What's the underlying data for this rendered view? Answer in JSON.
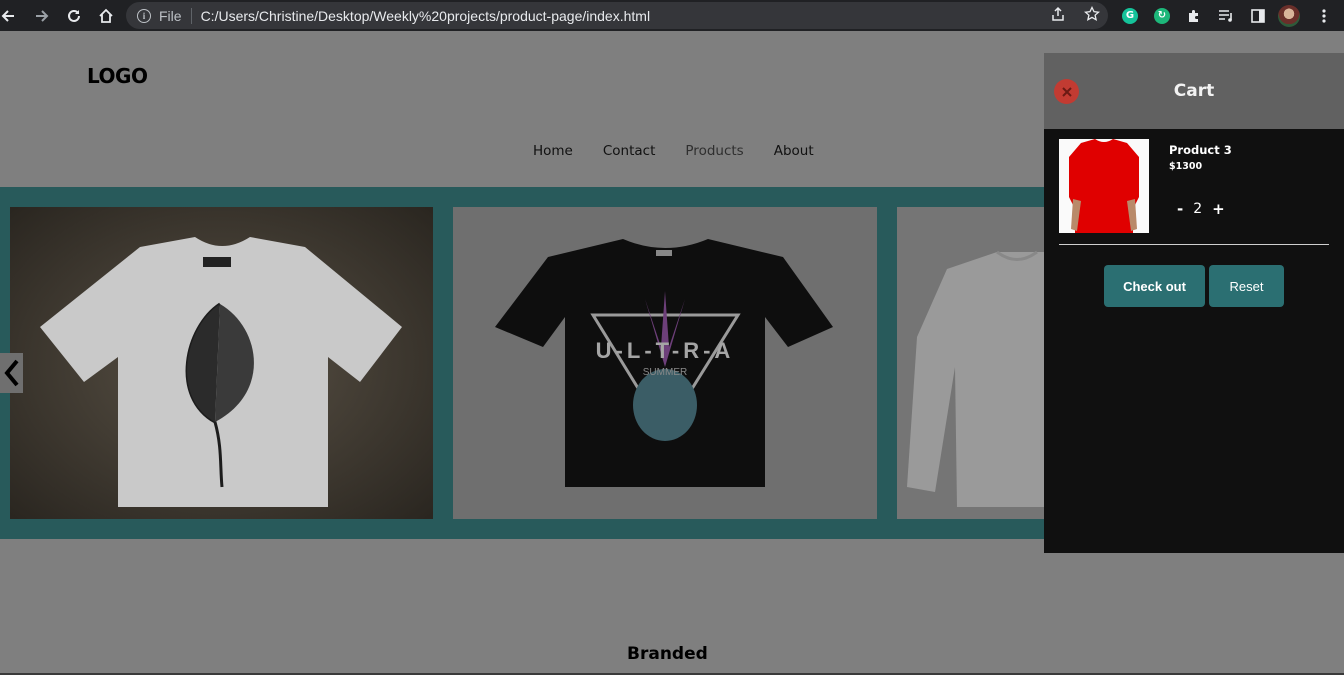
{
  "browser": {
    "protocol_label": "File",
    "url": "C:/Users/Christine/Desktop/Weekly%20projects/product-page/index.html"
  },
  "site": {
    "logo": "LOGO",
    "nav": [
      {
        "label": "Home"
      },
      {
        "label": "Contact"
      },
      {
        "label": "Products"
      },
      {
        "label": "About"
      }
    ],
    "section_title": "Branded"
  },
  "cart": {
    "title": "Cart",
    "item": {
      "name": "Product 3",
      "price": "$1300",
      "quantity": "2",
      "minus": "-",
      "plus": "+"
    },
    "checkout_label": "Check out",
    "reset_label": "Reset"
  },
  "colors": {
    "overlay_bg": "#7f7f7f",
    "carousel_bg": "#285a5b",
    "cart_bg": "#101010",
    "cart_header": "#616161",
    "button": "#2b6f72",
    "close": "#c23b32"
  }
}
